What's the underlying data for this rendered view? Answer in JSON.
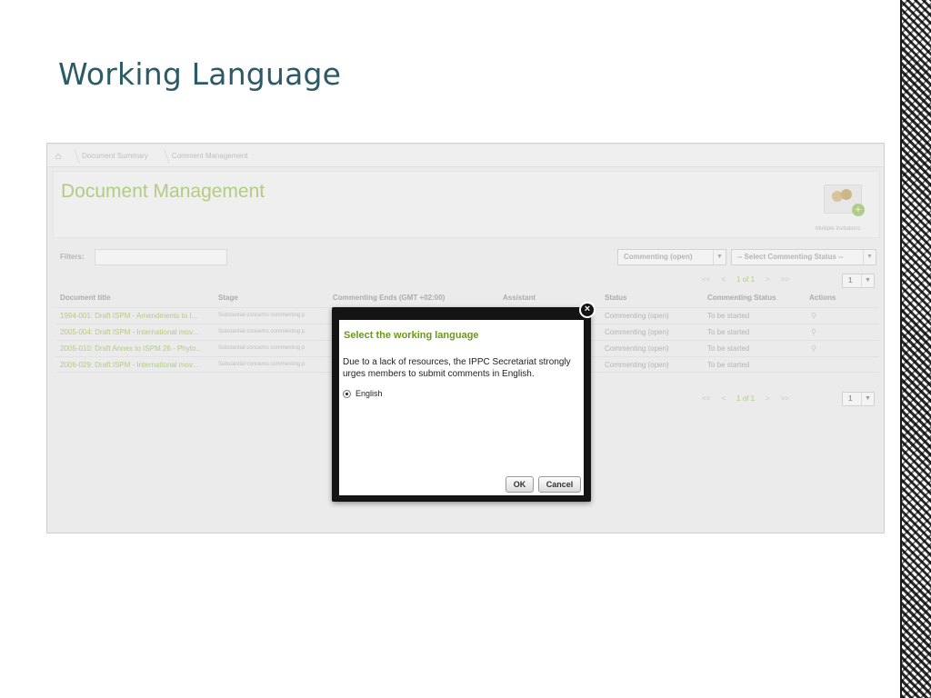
{
  "slide": {
    "title": "Working Language"
  },
  "breadcrumb": {
    "home_icon": "home-icon",
    "items": [
      "Document Summary",
      "Comment Management"
    ]
  },
  "header": {
    "title": "Document Management",
    "invitations_label": "Multiple Invitations"
  },
  "filters": {
    "label": "Filters:",
    "value": "",
    "status_select": "Commenting (open)",
    "commenting_status_select": "-- Select Commenting Status --"
  },
  "pager_top": {
    "first": "<<",
    "prev": "<",
    "info": "1 of 1",
    "next": ">",
    "last": ">>",
    "page": "1"
  },
  "pager_bottom": {
    "first": "<<",
    "prev": "<",
    "info": "1 of 1",
    "next": ">",
    "last": ">>",
    "page": "1"
  },
  "table": {
    "headers": [
      "Document title",
      "Stage",
      "Commenting Ends (GMT +02:00)",
      "Assistant",
      "Status",
      "Commenting Status",
      "Actions"
    ],
    "rows": [
      {
        "title": "1994-001: Draft ISPM - Amendments to I...",
        "stage": "Substantial concerns commenting p",
        "status": "Commenting (open)",
        "commenting_status": "To be started",
        "has_action": true
      },
      {
        "title": "2005-004: Draft ISPM - International mov...",
        "stage": "Substantial concerns commenting p",
        "status": "Commenting (open)",
        "commenting_status": "To be started",
        "has_action": true
      },
      {
        "title": "2005-010: Draft Annex to ISPM 26 - Phyto...",
        "stage": "Substantial concerns commenting p",
        "status": "Commenting (open)",
        "commenting_status": "To be started",
        "has_action": true
      },
      {
        "title": "2006-029: Draft ISPM - International mov...",
        "stage": "Substantial concerns commenting p",
        "status": "Commenting (open)",
        "commenting_status": "To be started",
        "has_action": false
      }
    ]
  },
  "modal": {
    "title": "Select the working language",
    "message": "Due to a lack of resources, the IPPC Secretariat strongly urges members to submit comments in English.",
    "option_label": "English",
    "ok_label": "OK",
    "cancel_label": "Cancel",
    "close_glyph": "×"
  }
}
